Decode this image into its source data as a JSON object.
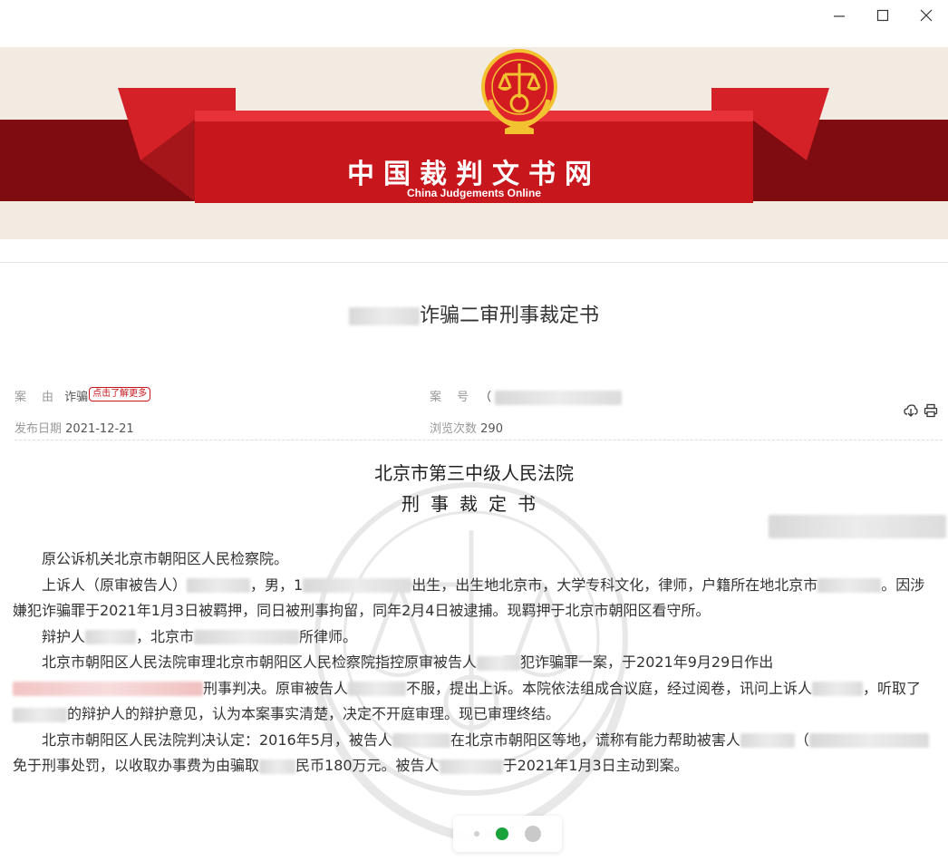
{
  "window": {
    "minimize_label": "–",
    "maximize_label": "□",
    "close_label": "×"
  },
  "banner": {
    "title": "中国裁判文书网",
    "subtitle": "China Judgements Online"
  },
  "document": {
    "title": "诈骗二审刑事裁定书",
    "meta": {
      "cause_label": "案　由",
      "cause_value": "诈骗",
      "more_tag": "点击了解更多",
      "case_no_label": "案　号",
      "case_no_value": "（",
      "publish_label": "发布日期",
      "publish_value": "2021-12-21",
      "views_label": "浏览次数",
      "views_value": "290"
    },
    "court_name": "北京市第三中级人民法院",
    "doc_type": "刑事裁定书",
    "paragraphs": [
      {
        "segments": [
          "原公诉机关北京市朝阳区人民检察院。"
        ]
      },
      {
        "segments": [
          "上诉人（原审被告人）",
          "，男，1",
          "出生，出生地北京市，大学专科文化，律师，户籍所在地北京市",
          "。因涉嫌犯诈骗罪于2021年1月3日被羁押，同日被刑事拘留，同年2月4日被逮捕。现羁押于北京市朝阳区看守所。"
        ]
      },
      {
        "segments": [
          "辩护人",
          "，北京市",
          "所律师。"
        ]
      },
      {
        "segments": [
          "北京市朝阳区人民法院审理北京市朝阳区人民检察院指控原审被告人",
          "犯诈骗罪一案，于2021年9月29日作出",
          "刑事判决。原审被告人",
          "不服，提出上诉。本院依法组成合议庭，经过阅卷，讯问上诉人",
          "，听取了",
          "的辩护人的辩护意见，认为本案事实清楚，决定不开庭审理。现已审理终结。"
        ]
      },
      {
        "segments": [
          "北京市朝阳区人民法院判决认定：2016年5月，被告人",
          "在北京市朝阳区等地，谎称有能力帮助被害人",
          "（",
          "免于刑事处罚，以收取办事费为由骗取",
          "民币180万元。被告人",
          "于2021年1月3日主动到案。"
        ]
      }
    ]
  },
  "colors": {
    "brand_red": "#c8161d",
    "dark_red": "#8e0f12",
    "gold": "#f2c230"
  },
  "pager": {
    "active_index": 1,
    "total": 3
  }
}
